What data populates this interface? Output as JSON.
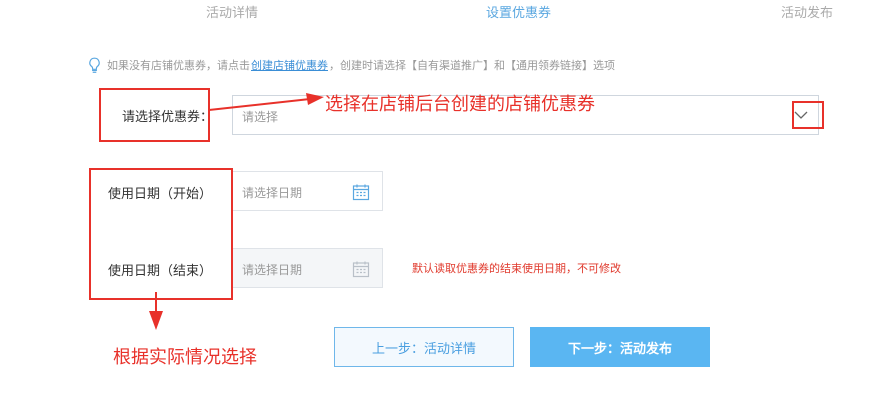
{
  "steps": [
    {
      "label": "活动详情",
      "active": false
    },
    {
      "label": "设置优惠券",
      "active": true
    },
    {
      "label": "活动发布",
      "active": false
    }
  ],
  "tip": {
    "icon": "lightbulb-icon",
    "prefix": "如果没有店铺优惠券，请点击",
    "link": "创建店铺优惠券",
    "suffix": "，创建时请选择【自有渠道推广】和【通用领券链接】选项"
  },
  "coupon": {
    "label": "请选择优惠券：",
    "placeholder": "请选择"
  },
  "start_date": {
    "label": "使用日期（开始）",
    "placeholder": "请选择日期"
  },
  "end_date": {
    "label": "使用日期（结束）",
    "placeholder": "请选择日期",
    "note": "默认读取优惠券的结束使用日期，不可修改"
  },
  "buttons": {
    "prev": "上一步：活动详情",
    "next": "下一步：活动发布"
  },
  "annotations": {
    "coupon_hint": "选择在店铺后台创建的店铺优惠券",
    "date_hint": "根据实际情况选择"
  },
  "colors": {
    "accent": "#5ab6f2",
    "annotation": "#e8312a",
    "note": "#e0392c"
  }
}
